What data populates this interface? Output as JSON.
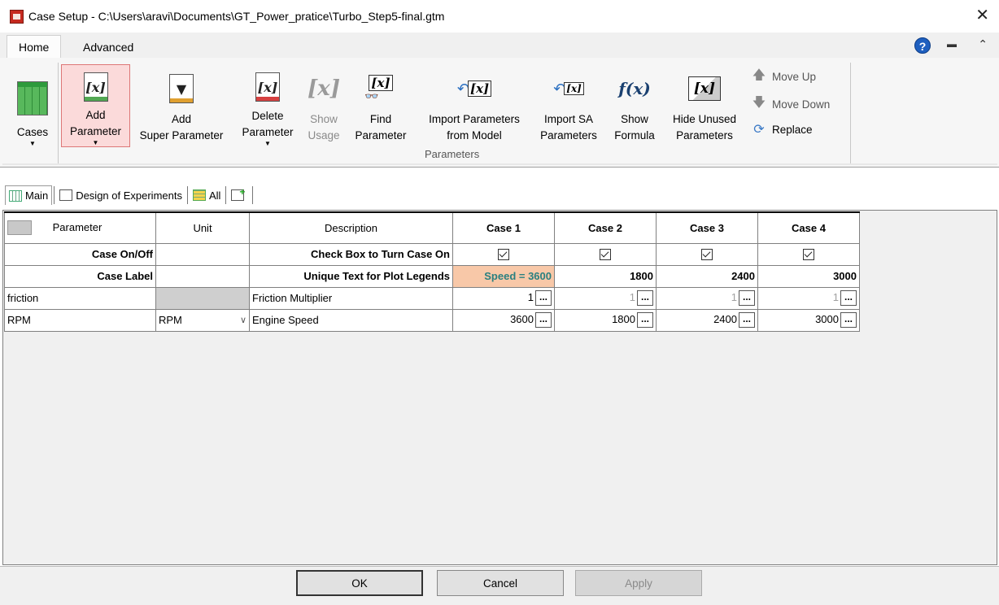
{
  "window": {
    "title": "Case Setup - C:\\Users\\aravi\\Documents\\GT_Power_pratice\\Turbo_Step5-final.gtm",
    "close_glyph": "✕"
  },
  "ribbon_tabs": [
    "Home",
    "Advanced"
  ],
  "ribbon": {
    "cases": {
      "label": "Cases"
    },
    "add_parameter": {
      "line1": "Add",
      "line2": "Parameter"
    },
    "add_super_parameter": {
      "line1": "Add",
      "line2": "Super Parameter"
    },
    "delete_parameter": {
      "line1": "Delete",
      "line2": "Parameter"
    },
    "show_usage": {
      "line1": "Show",
      "line2": "Usage"
    },
    "find_parameter": {
      "line1": "Find",
      "line2": "Parameter"
    },
    "import_parameters": {
      "line1": "Import Parameters",
      "line2": "from Model"
    },
    "import_sa": {
      "line1": "Import SA",
      "line2": "Parameters"
    },
    "show_formula": {
      "line1": "Show",
      "line2": "Formula"
    },
    "hide_unused": {
      "line1": "Hide Unused",
      "line2": "Parameters"
    },
    "move_up": "Move Up",
    "move_down": "Move Down",
    "replace": "Replace",
    "group_label": "Parameters"
  },
  "subtabs": {
    "main": "Main",
    "doe": "Design of Experiments",
    "all": "All"
  },
  "table": {
    "headers": {
      "parameter": "Parameter",
      "unit": "Unit",
      "description": "Description",
      "case1": "Case 1",
      "case2": "Case 2",
      "case3": "Case 3",
      "case4": "Case 4"
    },
    "case_onoff": {
      "label": "Case On/Off",
      "description": "Check Box to Turn Case On"
    },
    "case_label": {
      "label": "Case Label",
      "description": "Unique Text for Plot Legends",
      "values": [
        "Speed = 3600",
        "1800",
        "2400",
        "3000"
      ]
    },
    "friction": {
      "name": "friction",
      "description": "Friction Multiplier",
      "values": [
        "1",
        "1",
        "1",
        "1"
      ]
    },
    "rpm": {
      "name": "RPM",
      "unit": "RPM",
      "description": "Engine Speed",
      "values": [
        "3600",
        "1800",
        "2400",
        "3000"
      ]
    },
    "ellipsis": "..."
  },
  "footer": {
    "ok": "OK",
    "cancel": "Cancel",
    "apply": "Apply"
  },
  "colors": {
    "highlight_bg": "#f8c8a8",
    "highlight_text": "#2a8080",
    "active_button_bg": "#fbdada"
  }
}
